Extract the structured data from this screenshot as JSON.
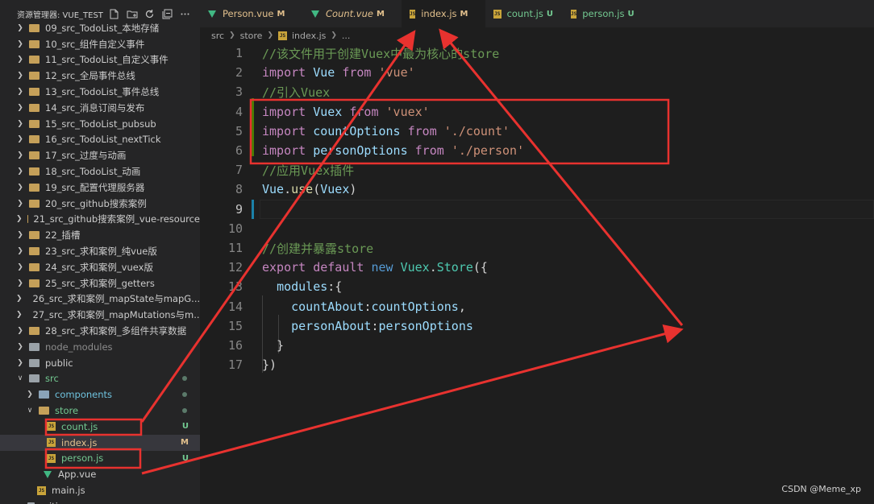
{
  "sidebar": {
    "title": "资源管理器: VUE_TEST",
    "actions": [
      "new-file-icon",
      "new-folder-icon",
      "refresh-icon",
      "collapse-icon",
      "more-icon"
    ],
    "rows": [
      {
        "label": "09_src_TodoList_本地存储",
        "type": "folder",
        "indent": 0,
        "open": false
      },
      {
        "label": "10_src_组件自定义事件",
        "type": "folder",
        "indent": 0,
        "open": false
      },
      {
        "label": "11_src_TodoList_自定义事件",
        "type": "folder",
        "indent": 0,
        "open": false
      },
      {
        "label": "12_src_全局事件总线",
        "type": "folder",
        "indent": 0,
        "open": false
      },
      {
        "label": "13_src_TodoList_事件总线",
        "type": "folder",
        "indent": 0,
        "open": false
      },
      {
        "label": "14_src_消息订阅与发布",
        "type": "folder",
        "indent": 0,
        "open": false
      },
      {
        "label": "15_src_TodoList_pubsub",
        "type": "folder",
        "indent": 0,
        "open": false
      },
      {
        "label": "16_src_TodoList_nextTick",
        "type": "folder",
        "indent": 0,
        "open": false
      },
      {
        "label": "17_src_过度与动画",
        "type": "folder",
        "indent": 0,
        "open": false
      },
      {
        "label": "18_src_TodoList_动画",
        "type": "folder",
        "indent": 0,
        "open": false
      },
      {
        "label": "19_src_配置代理服务器",
        "type": "folder",
        "indent": 0,
        "open": false
      },
      {
        "label": "20_src_github搜索案例",
        "type": "folder",
        "indent": 0,
        "open": false
      },
      {
        "label": "21_src_github搜索案例_vue-resource",
        "type": "folder",
        "indent": 0,
        "open": false
      },
      {
        "label": "22_插槽",
        "type": "folder",
        "indent": 0,
        "open": false
      },
      {
        "label": "23_src_求和案例_纯vue版",
        "type": "folder",
        "indent": 0,
        "open": false
      },
      {
        "label": "24_src_求和案例_vuex版",
        "type": "folder",
        "indent": 0,
        "open": false
      },
      {
        "label": "25_src_求和案例_getters",
        "type": "folder",
        "indent": 0,
        "open": false
      },
      {
        "label": "26_src_求和案例_mapState与mapG...",
        "type": "folder",
        "indent": 0,
        "open": false
      },
      {
        "label": "27_src_求和案例_mapMutations与m...",
        "type": "folder",
        "indent": 0,
        "open": false
      },
      {
        "label": "28_src_求和案例_多组件共享数据",
        "type": "folder",
        "indent": 0,
        "open": false
      },
      {
        "label": "node_modules",
        "type": "folder-grey",
        "indent": 0,
        "open": false,
        "dim": true
      },
      {
        "label": "public",
        "type": "folder-grey",
        "indent": 0,
        "open": false
      },
      {
        "label": "src",
        "type": "folder-grey",
        "indent": 0,
        "open": true,
        "color": "green",
        "mark": "dot"
      },
      {
        "label": "components",
        "type": "folder-blue",
        "indent": 1,
        "open": false,
        "color": "cyan",
        "mark": "dot"
      },
      {
        "label": "store",
        "type": "folder",
        "indent": 1,
        "open": true,
        "color": "green",
        "mark": "dot"
      },
      {
        "label": "count.js",
        "type": "js",
        "indent": 2,
        "color": "green",
        "badge": "U"
      },
      {
        "label": "index.js",
        "type": "js",
        "indent": 2,
        "color": "gold",
        "badge": "M",
        "selected": true
      },
      {
        "label": "person.js",
        "type": "js",
        "indent": 2,
        "color": "green",
        "badge": "U"
      },
      {
        "label": "App.vue",
        "type": "vue",
        "indent": 1
      },
      {
        "label": "main.js",
        "type": "js",
        "indent": 1
      },
      {
        "label": ".gitignore",
        "type": "file",
        "indent": 0
      }
    ]
  },
  "tabs": [
    {
      "name": "Person.vue",
      "status": "M",
      "icon": "vue",
      "italic": false
    },
    {
      "name": "Count.vue",
      "status": "M",
      "icon": "vue",
      "italic": true
    },
    {
      "name": "index.js",
      "status": "M",
      "icon": "js",
      "italic": false,
      "active": true,
      "dirty": true
    },
    {
      "name": "count.js",
      "status": "U",
      "icon": "js",
      "italic": false
    },
    {
      "name": "person.js",
      "status": "U",
      "icon": "js",
      "italic": false
    }
  ],
  "breadcrumb": {
    "p1": "src",
    "p2": "store",
    "p3": "index.js",
    "p4": "..."
  },
  "code": [
    {
      "n": "1",
      "tokens": [
        [
          "c-cm",
          "//该文件用于创建Vuex中最为核心的store"
        ]
      ]
    },
    {
      "n": "2",
      "tokens": [
        [
          "c-imp",
          "import"
        ],
        [
          "c-p",
          " "
        ],
        [
          "c-id",
          "Vue"
        ],
        [
          "c-p",
          " "
        ],
        [
          "c-imp",
          "from"
        ],
        [
          "c-p",
          " "
        ],
        [
          "c-str",
          "'vue'"
        ]
      ]
    },
    {
      "n": "3",
      "tokens": [
        [
          "c-cm",
          "//引入Vuex"
        ]
      ]
    },
    {
      "n": "4",
      "tokens": [
        [
          "c-imp",
          "import"
        ],
        [
          "c-p",
          " "
        ],
        [
          "c-id",
          "Vuex"
        ],
        [
          "c-p",
          " "
        ],
        [
          "c-imp",
          "from"
        ],
        [
          "c-p",
          " "
        ],
        [
          "c-str",
          "'vuex'"
        ]
      ]
    },
    {
      "n": "5",
      "tokens": [
        [
          "c-imp",
          "import"
        ],
        [
          "c-p",
          " "
        ],
        [
          "c-id",
          "countOptions"
        ],
        [
          "c-p",
          " "
        ],
        [
          "c-imp",
          "from"
        ],
        [
          "c-p",
          " "
        ],
        [
          "c-str",
          "'./count'"
        ]
      ]
    },
    {
      "n": "6",
      "tokens": [
        [
          "c-imp",
          "import"
        ],
        [
          "c-p",
          " "
        ],
        [
          "c-id",
          "personOptions"
        ],
        [
          "c-p",
          " "
        ],
        [
          "c-imp",
          "from"
        ],
        [
          "c-p",
          " "
        ],
        [
          "c-str",
          "'./person'"
        ]
      ]
    },
    {
      "n": "7",
      "tokens": [
        [
          "c-cm",
          "//应用Vuex插件"
        ]
      ]
    },
    {
      "n": "8",
      "tokens": [
        [
          "c-id",
          "Vue"
        ],
        [
          "c-p",
          "."
        ],
        [
          "c-fn",
          "use"
        ],
        [
          "c-p",
          "("
        ],
        [
          "c-id",
          "Vuex"
        ],
        [
          "c-p",
          ")"
        ]
      ]
    },
    {
      "n": "9",
      "tokens": [],
      "current": true
    },
    {
      "n": "10",
      "tokens": []
    },
    {
      "n": "11",
      "tokens": [
        [
          "c-cm",
          "//创建并暴露store"
        ]
      ]
    },
    {
      "n": "12",
      "tokens": [
        [
          "c-imp",
          "export"
        ],
        [
          "c-p",
          " "
        ],
        [
          "c-imp",
          "default"
        ],
        [
          "c-p",
          " "
        ],
        [
          "c-kw2",
          "new"
        ],
        [
          "c-p",
          " "
        ],
        [
          "c-cls",
          "Vuex"
        ],
        [
          "c-p",
          "."
        ],
        [
          "c-cls",
          "Store"
        ],
        [
          "c-p",
          "({"
        ]
      ]
    },
    {
      "n": "13",
      "tokens": [
        [
          "c-p",
          "  "
        ],
        [
          "c-id",
          "modules"
        ],
        [
          "c-p",
          ":{"
        ]
      ]
    },
    {
      "n": "14",
      "tokens": [
        [
          "c-p",
          "    "
        ],
        [
          "c-id",
          "countAbout"
        ],
        [
          "c-p",
          ":"
        ],
        [
          "c-id",
          "countOptions"
        ],
        [
          "c-p",
          ","
        ]
      ]
    },
    {
      "n": "15",
      "tokens": [
        [
          "c-p",
          "    "
        ],
        [
          "c-id",
          "personAbout"
        ],
        [
          "c-p",
          ":"
        ],
        [
          "c-id",
          "personOptions"
        ]
      ]
    },
    {
      "n": "16",
      "tokens": [
        [
          "c-p",
          "  }"
        ]
      ]
    },
    {
      "n": "17",
      "tokens": [
        [
          "c-p",
          "})"
        ]
      ]
    }
  ],
  "watermark": "CSDN @Meme_xp",
  "colors": {
    "annotation": "#e8322f",
    "accent": "#007acc"
  }
}
